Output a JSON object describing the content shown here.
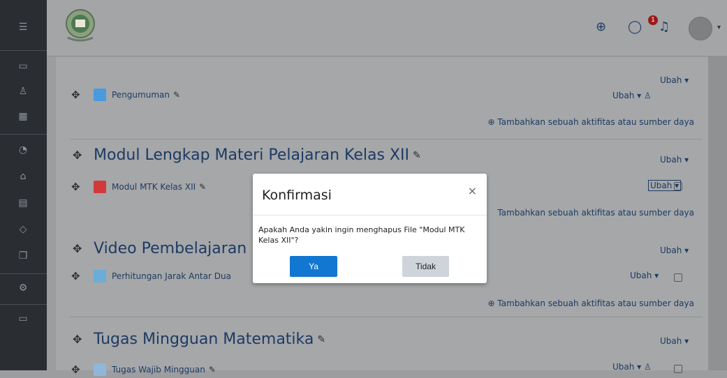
{
  "topbar": {
    "notification_count": "1"
  },
  "sections": [
    {
      "title": "",
      "item_label": "Pengumuman",
      "ubah_section": "Ubah ▾",
      "ubah_item": "Ubah ▾",
      "add_activity": "⊕ Tambahkan sebuah aktifitas atau sumber daya"
    },
    {
      "title": "Modul Lengkap Materi Pelajaran Kelas XII",
      "item_label": "Modul MTK Kelas XII",
      "ubah_section": "Ubah ▾",
      "ubah_item": "Ubah ▾",
      "add_activity": "Tambahkan sebuah aktifitas atau sumber daya"
    },
    {
      "title": "Video Pembelajaran",
      "item_label": "Perhitungan Jarak Antar Dua",
      "ubah_section": "Ubah ▾",
      "ubah_item": "Ubah ▾",
      "add_activity": "⊕ Tambahkan sebuah aktifitas atau sumber daya"
    },
    {
      "title": "Tugas Mingguan Matematika",
      "item_label": "Tugas Wajib Mingguan",
      "ubah_section": "Ubah ▾",
      "ubah_item": "Ubah ▾"
    }
  ],
  "modal": {
    "title": "Konfirmasi",
    "close": "×",
    "message": "Apakah Anda yakin ingin menghapus File \"Modul MTK Kelas XII\"?",
    "yes_label": "Ya",
    "no_label": "Tidak"
  },
  "icons": {
    "menu": "menu-icon",
    "globe": "globe-icon",
    "chat": "chat-icon",
    "bell": "bell-icon"
  },
  "colors": {
    "accent": "#1177d1",
    "link": "#1e3a63"
  }
}
